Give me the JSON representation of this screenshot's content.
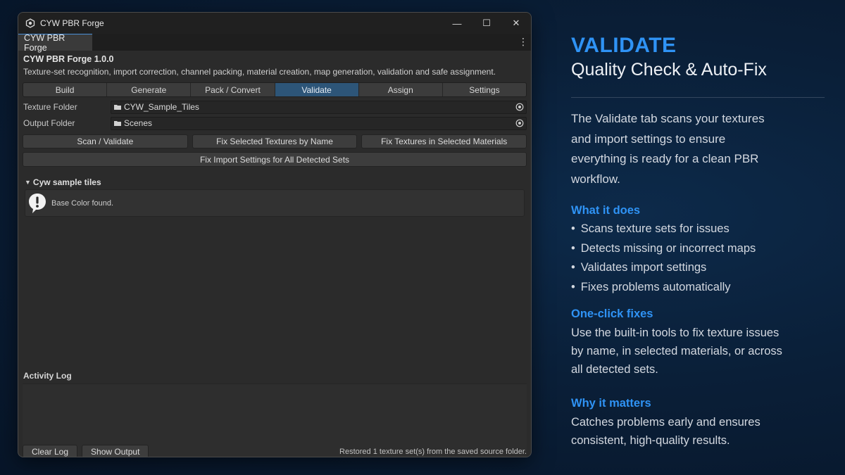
{
  "window": {
    "title": "CYW PBR Forge",
    "tab_label": "CYW PBR Forge",
    "minimize": "—",
    "maximize": "☐",
    "close": "✕",
    "menu": "⋮"
  },
  "app": {
    "name": "CYW PBR Forge 1.0.0",
    "description": "Texture-set recognition, import correction, channel packing, material creation, map generation, validation and safe assignment."
  },
  "tabs": [
    {
      "label": "Build"
    },
    {
      "label": "Generate"
    },
    {
      "label": "Pack / Convert"
    },
    {
      "label": "Validate",
      "active": true
    },
    {
      "label": "Assign"
    },
    {
      "label": "Settings"
    }
  ],
  "fields": {
    "texture_folder_label": "Texture Folder",
    "texture_folder_value": "CYW_Sample_Tiles",
    "output_folder_label": "Output Folder",
    "output_folder_value": "Scenes"
  },
  "actions": {
    "scan": "Scan / Validate",
    "fix_by_name": "Fix Selected Textures by Name",
    "fix_materials": "Fix Textures in Selected Materials",
    "fix_import": "Fix Import Settings for All Detected Sets"
  },
  "results": {
    "set_name": "Cyw sample tiles",
    "message": "Base Color found."
  },
  "log": {
    "title": "Activity Log",
    "clear": "Clear Log",
    "show_output": "Show Output",
    "status": "Restored 1 texture set(s) from the saved source folder."
  },
  "panel": {
    "headline": "VALIDATE",
    "subhead": "Quality Check & Auto-Fix",
    "intro": "The Validate tab scans your textures and import settings to ensure everything is ready for a clean PBR workflow.",
    "what_title": "What it does",
    "what_items": [
      "Scans texture sets for issues",
      "Detects missing or incorrect maps",
      "Validates import settings",
      "Fixes problems automatically"
    ],
    "oneclick_title": "One-click fixes",
    "oneclick_text": "Use the built-in tools to fix texture issues by name, in selected materials, or across all detected sets.",
    "why_title": "Why it matters",
    "why_text": "Catches problems early and ensures consistent, high-quality results."
  },
  "colors": {
    "accent": "#2f93f5",
    "active_tab": "#2d5578",
    "window_bg": "#2b2b2b",
    "page_bg": "#0a1f38"
  }
}
